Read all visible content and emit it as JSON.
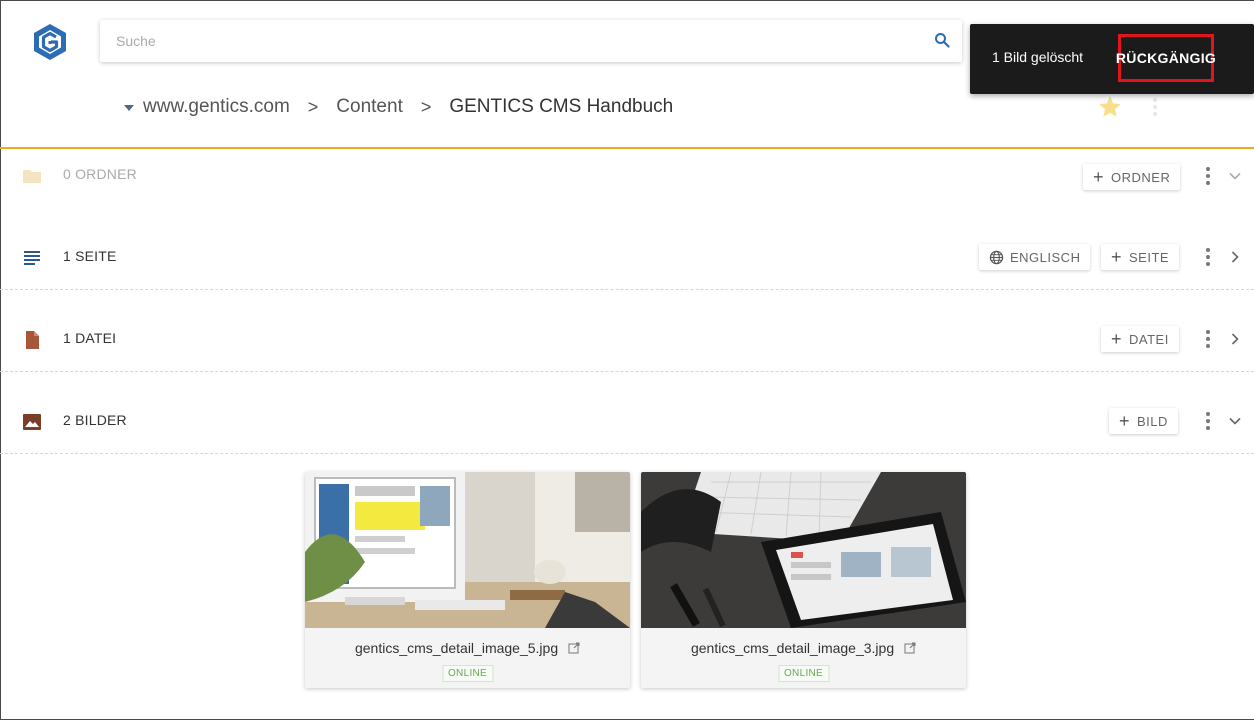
{
  "search": {
    "placeholder": "Suche"
  },
  "breadcrumb": {
    "items": [
      "www.gentics.com",
      "Content",
      "GENTICS CMS Handbuch"
    ]
  },
  "snackbar": {
    "message": "1 Bild gelöscht",
    "action_label": "RÜCKGÄNGIG"
  },
  "sections": [
    {
      "title": "0 ORDNER",
      "button": "ORDNER",
      "expanded": true,
      "faded": true
    },
    {
      "title": "1 SEITE",
      "language_button": "ENGLISCH",
      "button": "SEITE",
      "expanded": false
    },
    {
      "title": "1 DATEI",
      "button": "DATEI",
      "expanded": false
    },
    {
      "title": "2 BILDER",
      "button": "BILD",
      "expanded": true
    }
  ],
  "images": [
    {
      "name": "gentics_cms_detail_image_5.jpg",
      "status": "ONLINE"
    },
    {
      "name": "gentics_cms_detail_image_3.jpg",
      "status": "ONLINE"
    }
  ],
  "colors": {
    "accent": "#f5a623",
    "snackbar_bg": "#1b1b1b",
    "highlight_box": "#e1151d",
    "online": "#6aa84f"
  },
  "icons": [
    "gentics-logo-icon",
    "search-icon",
    "star-icon",
    "more-vert-icon",
    "folder-icon",
    "page-lines-icon",
    "file-icon",
    "image-icon",
    "globe-icon",
    "chevron-down-icon",
    "chevron-right-icon",
    "external-link-icon"
  ]
}
